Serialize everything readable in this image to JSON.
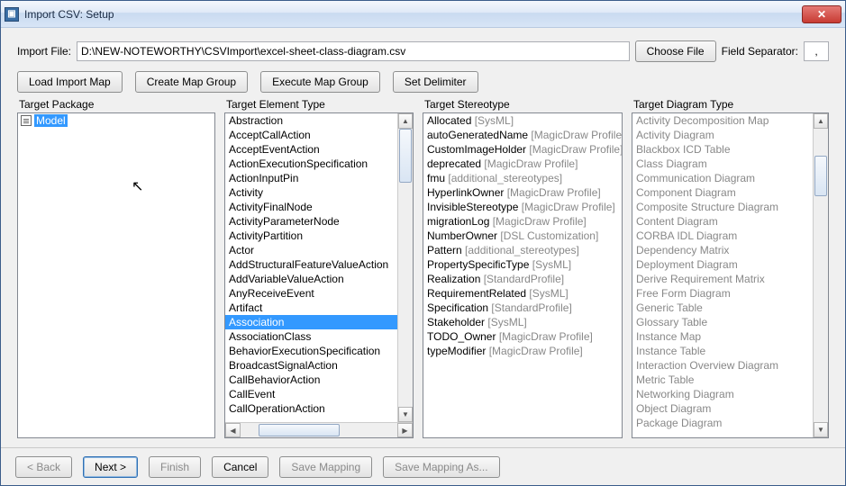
{
  "window": {
    "title": "Import CSV: Setup"
  },
  "importFile": {
    "label": "Import File:",
    "value": "D:\\NEW-NOTEWORTHY\\CSVImport\\excel-sheet-class-diagram.csv",
    "chooseBtn": "Choose File",
    "separatorLabel": "Field Separator:",
    "separatorValue": ","
  },
  "toolbar": {
    "loadMap": "Load Import Map",
    "createGroup": "Create Map Group",
    "executeGroup": "Execute Map Group",
    "setDelimiter": "Set Delimiter"
  },
  "cols": {
    "package": "Target Package",
    "elementType": "Target Element Type",
    "stereotype": "Target Stereotype",
    "diagramType": "Target Diagram Type"
  },
  "tree": {
    "root": "Model"
  },
  "elementTypes": [
    "Abstraction",
    "AcceptCallAction",
    "AcceptEventAction",
    "ActionExecutionSpecification",
    "ActionInputPin",
    "Activity",
    "ActivityFinalNode",
    "ActivityParameterNode",
    "ActivityPartition",
    "Actor",
    "AddStructuralFeatureValueAction",
    "AddVariableValueAction",
    "AnyReceiveEvent",
    "Artifact",
    "Association",
    "AssociationClass",
    "BehaviorExecutionSpecification",
    "BroadcastSignalAction",
    "CallBehaviorAction",
    "CallEvent",
    "CallOperationAction"
  ],
  "elementTypeSelectedIndex": 14,
  "stereotypes": [
    {
      "n": "Allocated",
      "p": "[SysML]"
    },
    {
      "n": "autoGeneratedName",
      "p": "[MagicDraw Profile]"
    },
    {
      "n": "CustomImageHolder",
      "p": "[MagicDraw Profile]"
    },
    {
      "n": "deprecated",
      "p": "[MagicDraw Profile]"
    },
    {
      "n": "fmu",
      "p": "[additional_stereotypes]"
    },
    {
      "n": "HyperlinkOwner",
      "p": "[MagicDraw Profile]"
    },
    {
      "n": "InvisibleStereotype",
      "p": "[MagicDraw Profile]"
    },
    {
      "n": "migrationLog",
      "p": "[MagicDraw Profile]"
    },
    {
      "n": "NumberOwner",
      "p": "[DSL Customization]"
    },
    {
      "n": "Pattern",
      "p": "[additional_stereotypes]"
    },
    {
      "n": "PropertySpecificType",
      "p": "[SysML]"
    },
    {
      "n": "Realization",
      "p": "[StandardProfile]"
    },
    {
      "n": "RequirementRelated",
      "p": "[SysML]"
    },
    {
      "n": "Specification",
      "p": "[StandardProfile]"
    },
    {
      "n": "Stakeholder",
      "p": "[SysML]"
    },
    {
      "n": "TODO_Owner",
      "p": "[MagicDraw Profile]"
    },
    {
      "n": "typeModifier",
      "p": "[MagicDraw Profile]"
    }
  ],
  "diagramTypes": [
    "Activity Decomposition Map",
    "Activity Diagram",
    "Blackbox ICD Table",
    "Class Diagram",
    "Communication Diagram",
    "Component Diagram",
    "Composite Structure Diagram",
    "Content Diagram",
    "CORBA IDL Diagram",
    "Dependency Matrix",
    "Deployment Diagram",
    "Derive Requirement Matrix",
    "Free Form Diagram",
    "Generic Table",
    "Glossary Table",
    "Instance Map",
    "Instance Table",
    "Interaction Overview Diagram",
    "Metric Table",
    "Networking Diagram",
    "Object Diagram",
    "Package Diagram"
  ],
  "footer": {
    "back": "< Back",
    "next": "Next >",
    "finish": "Finish",
    "cancel": "Cancel",
    "saveMapping": "Save Mapping",
    "saveMappingAs": "Save Mapping As..."
  }
}
